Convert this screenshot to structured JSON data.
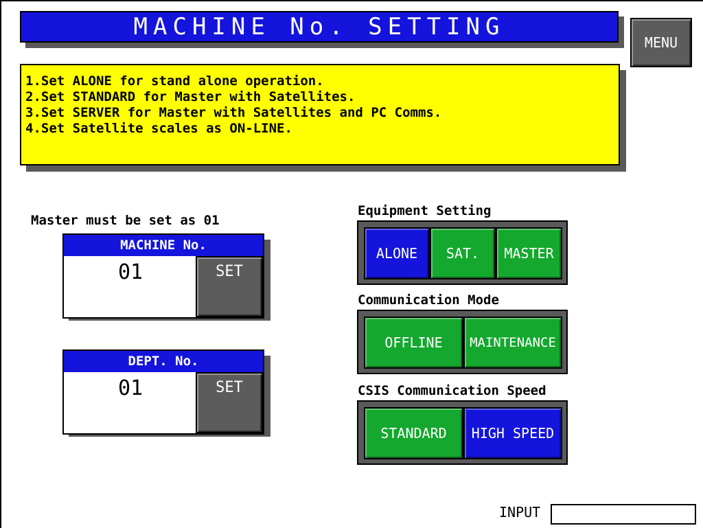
{
  "header": {
    "title": "MACHINE No. SETTING",
    "menu_label": "MENU"
  },
  "instructions": [
    "1.Set ALONE for stand alone operation.",
    "2.Set STANDARD for Master with Satellites.",
    "3.Set SERVER for Master with Satellites and PC Comms.",
    "4.Set Satellite scales as ON-LINE."
  ],
  "master_note": "Master must be set as 01",
  "machine_no": {
    "label": "MACHINE No.",
    "value": "01",
    "set_label": "SET"
  },
  "dept_no": {
    "label": "DEPT. No.",
    "value": "01",
    "set_label": "SET"
  },
  "equipment": {
    "label": "Equipment Setting",
    "options": [
      "ALONE",
      "SAT.",
      "MASTER"
    ],
    "selected": "ALONE"
  },
  "communication": {
    "label": "Communication Mode",
    "options": [
      "OFFLINE",
      "MAINTENANCE"
    ]
  },
  "csis": {
    "label": "CSIS Communication Speed",
    "options": [
      "STANDARD",
      "HIGH SPEED"
    ],
    "selected": "HIGH SPEED"
  },
  "input": {
    "label": "INPUT",
    "value": ""
  },
  "colors": {
    "selected": "#1414dc",
    "unselected": "#14a82e",
    "info_bg": "#ffff00",
    "button_gray": "#5c5c5c"
  }
}
